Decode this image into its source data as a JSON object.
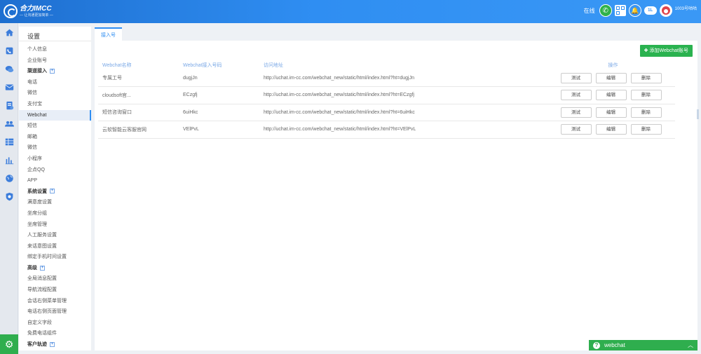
{
  "app": {
    "logo_name": "合力IMCC",
    "logo_slogan": "— 让沟通更加简单 —"
  },
  "header": {
    "status": "在线",
    "cloud_label": "1L",
    "user": "1003号咕咕"
  },
  "sidebar": {
    "title": "设置",
    "items": [
      {
        "label": "个人信息",
        "type": "item"
      },
      {
        "label": "企业账号",
        "type": "item"
      },
      {
        "label": "渠道接入",
        "type": "group"
      },
      {
        "label": "电话",
        "type": "item"
      },
      {
        "label": "微信",
        "type": "item"
      },
      {
        "label": "支付宝",
        "type": "item"
      },
      {
        "label": "Webchat",
        "type": "active"
      },
      {
        "label": "短信",
        "type": "item"
      },
      {
        "label": "邮箱",
        "type": "item"
      },
      {
        "label": "微信",
        "type": "item"
      },
      {
        "label": "小程序",
        "type": "item"
      },
      {
        "label": "企点QQ",
        "type": "item"
      },
      {
        "label": "APP",
        "type": "item"
      },
      {
        "label": "系统设置",
        "type": "group"
      },
      {
        "label": "满意度设置",
        "type": "item"
      },
      {
        "label": "坐席分组",
        "type": "item"
      },
      {
        "label": "坐席管理",
        "type": "item"
      },
      {
        "label": "人工服务设置",
        "type": "item"
      },
      {
        "label": "来话意图设置",
        "type": "item"
      },
      {
        "label": "绑定手机时间设置",
        "type": "item"
      },
      {
        "label": "高级",
        "type": "group"
      },
      {
        "label": "全局消息配置",
        "type": "item"
      },
      {
        "label": "导航流程配置",
        "type": "item"
      },
      {
        "label": "会话右侧菜单管理",
        "type": "item"
      },
      {
        "label": "电话右侧页面管理",
        "type": "item"
      },
      {
        "label": "自定义字段",
        "type": "item"
      },
      {
        "label": "免费电话组件",
        "type": "item"
      },
      {
        "label": "客户轨迹",
        "type": "group"
      }
    ]
  },
  "main": {
    "tab": "接入号",
    "add_button": "添加Webchat账号",
    "columns": [
      "Webchat名称",
      "Webchat接入号码",
      "访问地址",
      "操作"
    ],
    "rows": [
      {
        "name": "专属工号",
        "code": "dugjJn",
        "url": "http://uchat.im-cc.com/webchat_new/static/html/index.html?ht=dugjJn"
      },
      {
        "name": "cloudsoft官...",
        "code": "ECzgfj",
        "url": "http://uchat.im-cc.com/webchat_new/static/html/index.html?ht=ECzgfj"
      },
      {
        "name": "短信咨询窗口",
        "code": "6uiHkc",
        "url": "http://uchat.im-cc.com/webchat_new/static/html/index.html?ht=6uiHkc"
      },
      {
        "name": "云软智能云客服官网",
        "code": "VElPvL",
        "url": "http://uchat.im-cc.com/webchat_new/static/html/index.html?ht=VElPvL"
      }
    ],
    "actions": {
      "test": "测试",
      "edit": "编辑",
      "delete": "删除"
    }
  },
  "widget": {
    "label": "webchat"
  },
  "colors": {
    "header": "#2f8ef2",
    "accent": "#2f8ef2",
    "green": "#2ab24f"
  }
}
